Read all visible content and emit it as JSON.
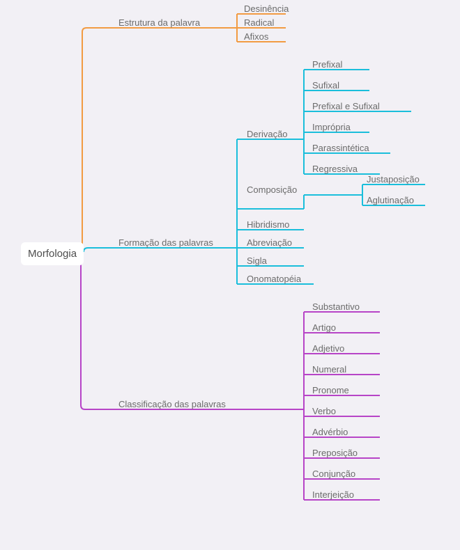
{
  "root": "Morfologia",
  "branch1": {
    "label": "Estrutura da palavra",
    "children": [
      "Desinência",
      "Radical",
      "Afixos"
    ]
  },
  "branch2": {
    "label": "Formação das palavras",
    "sub1": {
      "label": "Derivação",
      "children": [
        "Prefixal",
        "Sufixal",
        "Prefixal e Sufixal",
        "Imprópria",
        "Parassintética",
        "Regressiva"
      ]
    },
    "sub2": {
      "label": "Composição",
      "children": [
        "Justaposição",
        "Aglutinação"
      ]
    },
    "others": [
      "Hibridismo",
      "Abreviação",
      "Sigla",
      "Onomatopéia"
    ]
  },
  "branch3": {
    "label": "Classificação das palavras",
    "children": [
      "Substantivo",
      "Artigo",
      "Adjetivo",
      "Numeral",
      "Pronome",
      "Verbo",
      "Advérbio",
      "Preposição",
      "Conjunção",
      "Interjeição"
    ]
  },
  "colors": {
    "orange": "#f29b42",
    "cyan": "#1abedb",
    "purple": "#b744c7"
  }
}
